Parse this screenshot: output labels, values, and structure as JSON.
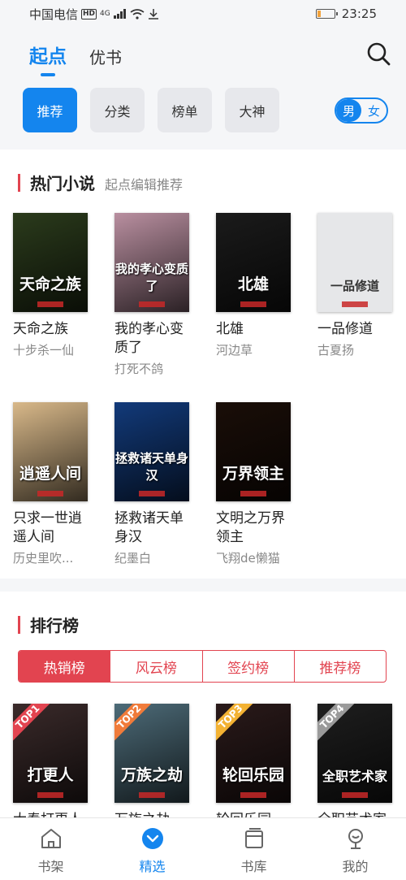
{
  "status": {
    "carrier": "中国电信",
    "hd": "HD",
    "signal": "4G",
    "time": "23:25",
    "battery_level": 0.25
  },
  "header": {
    "tabs": [
      {
        "label": "起点",
        "active": true
      },
      {
        "label": "优书",
        "active": false
      }
    ],
    "categories": [
      {
        "label": "推荐",
        "active": true
      },
      {
        "label": "分类"
      },
      {
        "label": "榜单"
      },
      {
        "label": "大神"
      }
    ],
    "gender": {
      "male": "男",
      "female": "女",
      "selected": "男"
    }
  },
  "hot": {
    "title": "热门小说",
    "subtitle": "起点编辑推荐",
    "books": [
      {
        "name": "天命之族",
        "author": "十步杀一仙",
        "cover_text": "天命之族",
        "cover_color": "#2b3b1c"
      },
      {
        "name": "我的孝心变质了",
        "author": "打死不鸽",
        "cover_text": "我的孝心变质了",
        "cover_color": "#b98fa0"
      },
      {
        "name": "北雄",
        "author": "河边草",
        "cover_text": "北雄",
        "cover_color": "#1b1b1b"
      },
      {
        "name": "一品修道",
        "author": "古夏扬",
        "cover_text": "一品修道",
        "cover_color": "#e6e7e9"
      },
      {
        "name": "只求一世逍遥人间",
        "author": "历史里吹...",
        "cover_text": "逍遥人间",
        "cover_color": "#d9b98a"
      },
      {
        "name": "拯救诸天单身汉",
        "author": "纪墨白",
        "cover_text": "拯救诸天单身汉",
        "cover_color": "#123a7a"
      },
      {
        "name": "文明之万界领主",
        "author": "飞翔de懒猫",
        "cover_text": "万界领主",
        "cover_color": "#1a0e08"
      }
    ]
  },
  "rank": {
    "title": "排行榜",
    "tabs": [
      {
        "label": "热销榜",
        "active": true
      },
      {
        "label": "风云榜"
      },
      {
        "label": "签约榜"
      },
      {
        "label": "推荐榜"
      }
    ],
    "books": [
      {
        "badge": "TOP1",
        "badge_color": "#e24450",
        "cover_text": "打更人",
        "cover_color": "#3a2a2a",
        "name": "大奉打更人"
      },
      {
        "badge": "TOP2",
        "badge_color": "#f07b3a",
        "cover_text": "万族之劫",
        "cover_color": "#4d6b78",
        "name": "万族之劫"
      },
      {
        "badge": "TOP3",
        "badge_color": "#f3b233",
        "cover_text": "轮回乐园",
        "cover_color": "#2a1a1a",
        "name": "轮回乐园"
      },
      {
        "badge": "TOP4",
        "badge_color": "#9a9a9a",
        "cover_text": "全职艺术家",
        "cover_color": "#1e1e1e",
        "name": "全职艺术家"
      }
    ]
  },
  "nav": [
    {
      "label": "书架",
      "icon": "home-icon",
      "active": false
    },
    {
      "label": "精选",
      "icon": "featured-icon",
      "active": true
    },
    {
      "label": "书库",
      "icon": "library-icon",
      "active": false
    },
    {
      "label": "我的",
      "icon": "profile-icon",
      "active": false
    }
  ]
}
